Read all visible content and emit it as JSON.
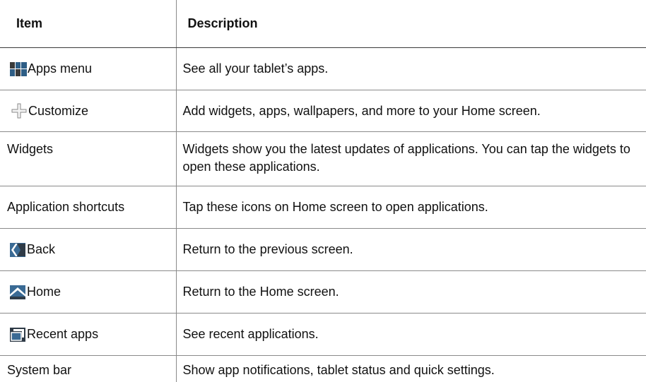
{
  "table": {
    "headers": {
      "item": "Item",
      "description": "Description"
    },
    "rows": [
      {
        "icon": "apps-grid-icon",
        "item": "Apps menu",
        "description": "See all your tablet’s apps."
      },
      {
        "icon": "plus-icon",
        "item": "Customize",
        "description": "Add widgets, apps, wallpapers, and more to your Home screen."
      },
      {
        "icon": "",
        "item": "Widgets",
        "description": "Widgets show you the latest updates of applications. You can tap the widgets to open these applications."
      },
      {
        "icon": "",
        "item": "Application shortcuts",
        "description": "Tap these icons on Home screen to open applications."
      },
      {
        "icon": "back-arrow-icon",
        "item": "Back",
        "description": "Return to the previous screen."
      },
      {
        "icon": "home-icon",
        "item": "Home",
        "description": "Return to the Home screen."
      },
      {
        "icon": "recent-apps-icon",
        "item": "Recent apps",
        "description": "See recent applications."
      },
      {
        "icon": "",
        "item": "System bar",
        "description": "Show app notifications, tablet status and quick settings."
      }
    ]
  }
}
